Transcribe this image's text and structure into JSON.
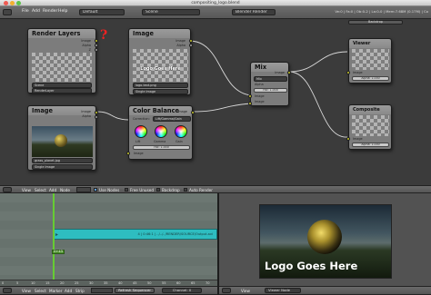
{
  "window": {
    "title": "compositing_logo.blend"
  },
  "topbar": {
    "menus": [
      "File",
      "Add",
      "Render",
      "Help"
    ],
    "layout": "Default",
    "scene": "Scene",
    "engine": "Blender Render",
    "stats": "Ve:0 | Fa:0 | Ob:0-2 | La:0-0 | Mem:7.68M (0.17M) | Co"
  },
  "node_editor": {
    "nodes": {
      "render_layers": {
        "title": "Render Layers",
        "outputs": [
          "Image",
          "Alpha",
          "Z"
        ],
        "scene": "Scene",
        "layer": "RenderLayer"
      },
      "image_logo": {
        "title": "Image",
        "outputs": [
          "Image",
          "Alpha"
        ],
        "file": "logo-text.png",
        "source": "Single Image",
        "preview_text": "Logo Goes Here"
      },
      "image_bg": {
        "title": "Image",
        "outputs": [
          "Image",
          "Alpha"
        ],
        "file": "grass_planet.jpg",
        "source": "Single Image"
      },
      "color_balance": {
        "title": "Color Balance",
        "correction_label": "Correction:",
        "correction": "Lift/Gamma/Gain",
        "wheels": [
          "Lift",
          "Gamma",
          "Gain"
        ],
        "fac": "Fac: 1.000",
        "inputs": [
          "Image"
        ],
        "outputs": [
          "Image"
        ]
      },
      "mix": {
        "title": "Mix",
        "mode": "Mix",
        "use_alpha": "Alpha",
        "fac": "Fac: 1.000",
        "inputs": [
          "Image",
          "Image"
        ],
        "outputs": [
          "Image"
        ]
      },
      "viewer": {
        "title": "Viewer",
        "outputs": [
          "Image",
          "Alpha"
        ],
        "alpha_field": "Alpha: 1.000"
      },
      "composite": {
        "title": "Composite",
        "inputs": [
          "Image",
          "Alpha"
        ],
        "alpha_field": "Alpha: 1.000"
      }
    },
    "backdrop_label": "Backdrop",
    "annotation": "?"
  },
  "node_header": {
    "items": [
      "View",
      "Select",
      "Add",
      "Node"
    ],
    "use_nodes": "Use Nodes",
    "free_unused": "Free Unused",
    "backdrop": "Backdrop",
    "auto_render": "Auto Render"
  },
  "sequencer": {
    "strip_label": "4 | 0:46:1 | ../../../RENDER/SOURCE/Output.avi",
    "frame_badge": "0+43",
    "ticks": [
      "0",
      "5",
      "10",
      "15",
      "20",
      "25",
      "30",
      "35",
      "40",
      "45",
      "50",
      "55",
      "60",
      "65",
      "70"
    ]
  },
  "seq_header": {
    "items": [
      "View",
      "Select",
      "Marker",
      "Add",
      "Strip"
    ],
    "refresh": "Refresh Sequencer",
    "channel": "Channel: 0"
  },
  "preview": {
    "text": "Logo Goes Here"
  },
  "preview_header": {
    "items": [
      "View"
    ],
    "mode": "Viewer Node"
  },
  "colors": {
    "background": "#3b3b3b",
    "node": "#7c7c7c",
    "strip": "#2ebdc0",
    "frame_line": "#66cc33"
  }
}
